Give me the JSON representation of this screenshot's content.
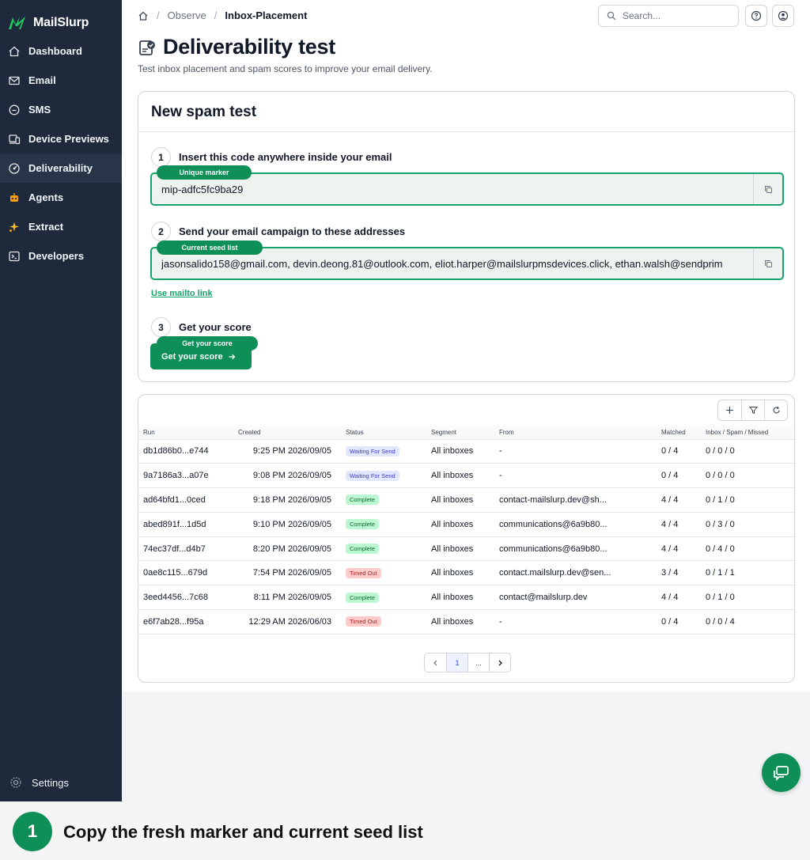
{
  "app": {
    "name": "MailSlurp",
    "brand_color": "#0e8f57",
    "sidebar_bg": "#1e293b"
  },
  "sidebar": {
    "items": [
      {
        "label": "Dashboard",
        "icon": "home-icon"
      },
      {
        "label": "Email",
        "icon": "mail-icon"
      },
      {
        "label": "SMS",
        "icon": "chat-bubble-icon"
      },
      {
        "label": "Device Previews",
        "icon": "devices-icon"
      },
      {
        "label": "Deliverability",
        "icon": "gauge-icon",
        "active": true
      },
      {
        "label": "Agents",
        "icon": "robot-icon"
      },
      {
        "label": "Extract",
        "icon": "sparkle-icon"
      },
      {
        "label": "Developers",
        "icon": "terminal-icon"
      }
    ],
    "settings_label": "Settings"
  },
  "breadcrumb": {
    "items": [
      "Observe",
      "Inbox-Placement"
    ]
  },
  "search": {
    "placeholder": "Search..."
  },
  "page": {
    "title": "Deliverability test",
    "subtitle": "Test inbox placement and spam scores to improve your email delivery."
  },
  "spam_test": {
    "title": "New spam test",
    "step1": {
      "num": "1",
      "label": "Insert this code anywhere inside your email",
      "pill": "Unique marker",
      "value": "mip-adfc5fc9ba29"
    },
    "step2": {
      "num": "2",
      "label": "Send your email campaign to these addresses",
      "pill": "Current seed list",
      "value": "jasonsalido158@gmail.com, devin.deong.81@outlook.com, eliot.harper@mailslurpmsdevices.click, ethan.walsh@sendprim",
      "link": "Use mailto link"
    },
    "step3": {
      "num": "3",
      "label": "Get your score",
      "pill": "Get your score",
      "button": "Get your score"
    }
  },
  "table": {
    "columns": [
      "Run",
      "Created",
      "Status",
      "Segment",
      "From",
      "Matched",
      "Inbox / Spam / Missed"
    ],
    "rows": [
      {
        "run": "db1d86b0...e744",
        "created": "9:25 PM 2026/09/05",
        "status": "Waiting For Send",
        "segment": "All inboxes",
        "from": "-",
        "matched": "0 / 4",
        "ism": "0 / 0 / 0"
      },
      {
        "run": "9a7186a3...a07e",
        "created": "9:08 PM 2026/09/05",
        "status": "Waiting For Send",
        "segment": "All inboxes",
        "from": "-",
        "matched": "0 / 4",
        "ism": "0 / 0 / 0"
      },
      {
        "run": "ad64bfd1...0ced",
        "created": "9:18 PM 2026/09/05",
        "status": "Complete",
        "segment": "All inboxes",
        "from": "contact-mailslurp.dev@sh...",
        "matched": "4 / 4",
        "ism": "0 / 1 / 0"
      },
      {
        "run": "abed891f...1d5d",
        "created": "9:10 PM 2026/09/05",
        "status": "Complete",
        "segment": "All inboxes",
        "from": "communications@6a9b80...",
        "matched": "4 / 4",
        "ism": "0 / 3 / 0"
      },
      {
        "run": "74ec37df...d4b7",
        "created": "8:20 PM 2026/09/05",
        "status": "Complete",
        "segment": "All inboxes",
        "from": "communications@6a9b80...",
        "matched": "4 / 4",
        "ism": "0 / 4 / 0"
      },
      {
        "run": "0ae8c115...679d",
        "created": "7:54 PM 2026/09/05",
        "status": "Timed Out",
        "segment": "All inboxes",
        "from": "contact.mailslurp.dev@sen...",
        "matched": "3 / 4",
        "ism": "0 / 1 / 1"
      },
      {
        "run": "3eed4456...7c68",
        "created": "8:11 PM 2026/09/05",
        "status": "Complete",
        "segment": "All inboxes",
        "from": "contact@mailslurp.dev",
        "matched": "4 / 4",
        "ism": "0 / 1 / 0"
      },
      {
        "run": "e6f7ab28...f95a",
        "created": "12:29 AM 2026/06/03",
        "status": "Timed Out",
        "segment": "All inboxes",
        "from": "-",
        "matched": "0 / 4",
        "ism": "0 / 0 / 4"
      }
    ],
    "status_colors": {
      "Waiting For Send": {
        "bg": "#e0e7ff",
        "fg": "#4338ca"
      },
      "Complete": {
        "bg": "#bbf7d0",
        "fg": "#166534"
      },
      "Timed Out": {
        "bg": "#fecaca",
        "fg": "#b91c1c"
      }
    }
  },
  "pagination": {
    "current": "1",
    "ellipsis": "..."
  },
  "caption": {
    "num": "1",
    "text": "Copy the fresh marker and current seed list"
  }
}
